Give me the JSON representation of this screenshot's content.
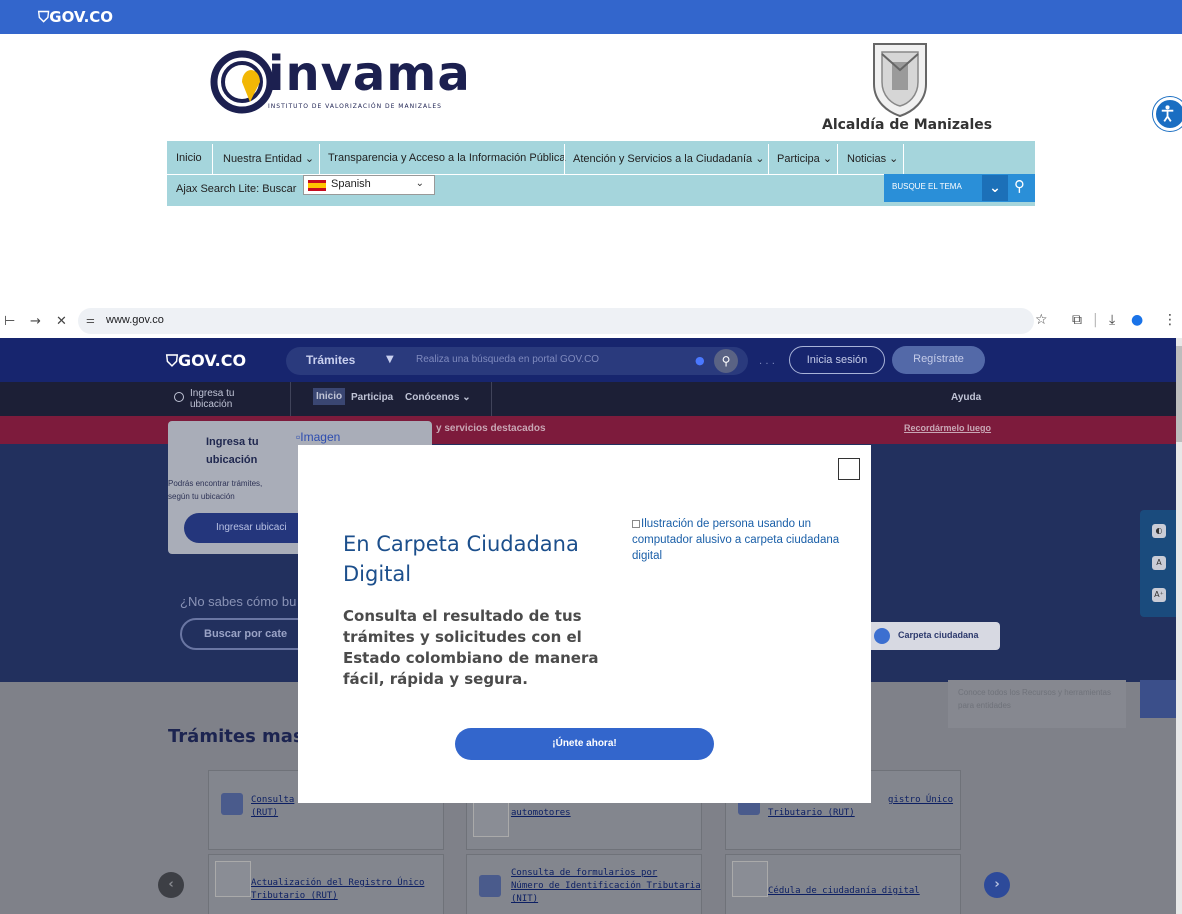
{
  "top_bar": {
    "logo": "GOV.CO"
  },
  "invama": {
    "brand": "invama",
    "tagline": "INSTITUTO DE VALORIZACIÓN DE MANIZALES",
    "alcaldia": "Alcaldía de Manizales"
  },
  "menu": {
    "items": [
      "Inicio",
      "Nuestra Entidad ⌄",
      "Transparencia y Acceso a la Información Pública",
      "Atención y Servicios a la Ciudadanía ⌄",
      "Participa ⌄",
      "Noticias ⌄"
    ],
    "ajax": "Ajax Search Lite: Buscar",
    "language": "Spanish",
    "busque": "BUSQUE EL TEMA"
  },
  "browser": {
    "url": "www.gov.co"
  },
  "govco": {
    "logo": "GOV.CO",
    "search_scope": "Trámites",
    "search_placeholder": "Realiza una búsqueda en portal GOV.CO",
    "login": "Inicia sesión",
    "register": "Regístrate",
    "location_line1": "Ingresa tu",
    "location_line2": "ubicación",
    "tabs": [
      "Inicio",
      "Participa",
      "Conócenos ⌄"
    ],
    "help": "Ayuda",
    "alert_text": "y servicios destacados",
    "alert_link": "Recordármelo luego",
    "loc_popup_title_1": "Ingresa tu",
    "loc_popup_title_2": "ubicación",
    "loc_popup_img": "Imagen",
    "loc_popup_text_1": "Podrás encontrar trámites,",
    "loc_popup_text_2": "según tu ubicación",
    "loc_popup_btn": "Ingresar ubicaci",
    "no_sabes": "¿No sabes cómo bu",
    "buscar_cat": "Buscar por cate",
    "carpeta_btn": "Carpeta ciudadana",
    "tools": [
      "◐",
      "A",
      "A⁺"
    ],
    "conoce": "Conoce todos los Recursos y herramientas para entidades",
    "tramites_title": "Trámites mas",
    "cards": [
      {
        "line1": "Consulta",
        "line2": "(RUT)"
      },
      {
        "line1": "",
        "line2": "automotores"
      },
      {
        "line1": "gistro Único",
        "line2": "Tributario (RUT)"
      },
      {
        "line1": "Actualización del Registro Único",
        "line2": "Tributario (RUT)"
      },
      {
        "line1": "Consulta de formularios por",
        "line2": "Número de Identificación Tributaria",
        "line3": "(NIT)"
      },
      {
        "line1": "Cédula de ciudadanía digital",
        "line2": ""
      }
    ]
  },
  "modal": {
    "title": "En Carpeta Ciudadana Digital",
    "description": "Consulta el resultado de tus trámites y solicitudes con el Estado colombiano de manera fácil, rápida y segura.",
    "image_alt": "Ilustración de persona usando un computador alusivo a carpeta ciudadana digital",
    "cta": "¡Únete ahora!"
  },
  "colors": {
    "gov_blue": "#3366cc",
    "menu_teal": "#a5d5dc",
    "modal_title": "#1c4f8c"
  }
}
